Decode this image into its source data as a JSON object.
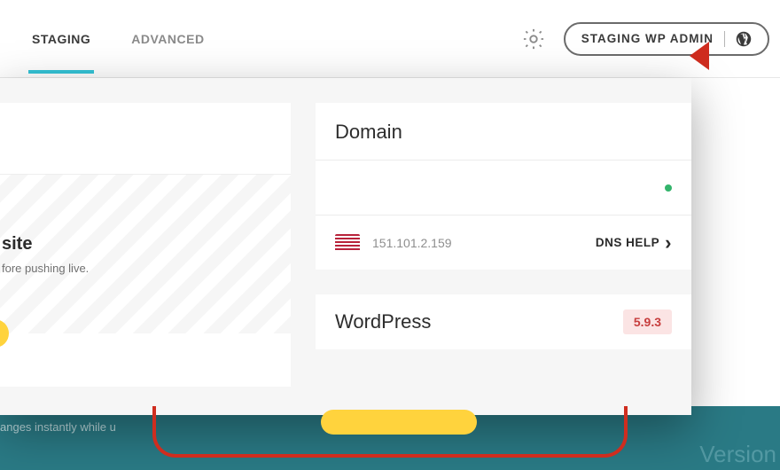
{
  "tabs": {
    "staging": "STAGING",
    "advanced": "ADVANCED"
  },
  "header": {
    "admin_button": "STAGING WP ADMIN"
  },
  "left": {
    "title": "site",
    "subtitle": "fore pushing live."
  },
  "domain": {
    "title": "Domain",
    "ip": "151.101.2.159",
    "dns_help": "DNS HELP"
  },
  "wordpress": {
    "title": "WordPress",
    "version": "5.9.3"
  },
  "bg": {
    "left_text": "anges instantly while u",
    "right_text": "Version"
  }
}
